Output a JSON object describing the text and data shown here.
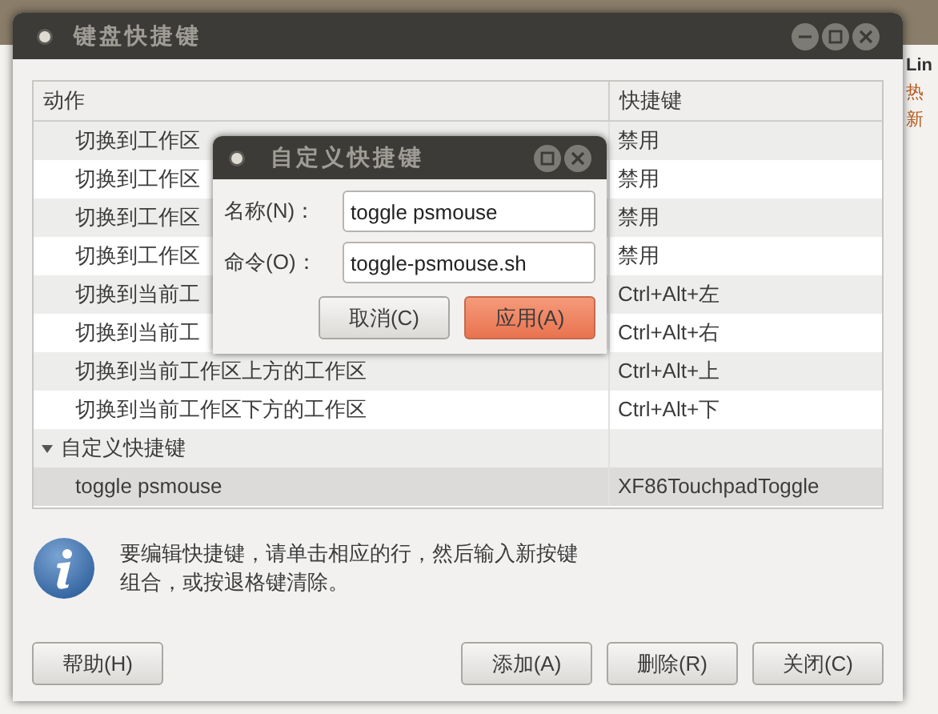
{
  "background": {
    "right_texts": [
      "Lin",
      "热",
      "新"
    ]
  },
  "window": {
    "title": "键盘快捷键"
  },
  "table": {
    "columns": [
      "动作",
      "快捷键"
    ],
    "rows": [
      {
        "kind": "item",
        "action": "切换到工作区",
        "shortcut": "禁用",
        "selected": false
      },
      {
        "kind": "item",
        "action": "切换到工作区",
        "shortcut": "禁用",
        "selected": false
      },
      {
        "kind": "item",
        "action": "切换到工作区",
        "shortcut": "禁用",
        "selected": false
      },
      {
        "kind": "item",
        "action": "切换到工作区",
        "shortcut": "禁用",
        "selected": false
      },
      {
        "kind": "item",
        "action": "切换到当前工",
        "shortcut": "Ctrl+Alt+左",
        "selected": false
      },
      {
        "kind": "item",
        "action": "切换到当前工",
        "shortcut": "Ctrl+Alt+右",
        "selected": false
      },
      {
        "kind": "item",
        "action": "切换到当前工作区上方的工作区",
        "shortcut": "Ctrl+Alt+上",
        "selected": false
      },
      {
        "kind": "item",
        "action": "切换到当前工作区下方的工作区",
        "shortcut": "Ctrl+Alt+下",
        "selected": false
      },
      {
        "kind": "group",
        "label": "自定义快捷键",
        "expanded": true
      },
      {
        "kind": "item",
        "action": "toggle psmouse",
        "shortcut": "XF86TouchpadToggle",
        "selected": true
      }
    ]
  },
  "info": {
    "lines": [
      "要编辑快捷键，请单击相应的行，然后输入新按键",
      "组合，或按退格键清除。"
    ]
  },
  "buttons": [
    {
      "label": "帮助(H)",
      "kind": "left"
    },
    {
      "label": "添加(A)",
      "kind": "right"
    },
    {
      "label": "删除(R)",
      "kind": "right"
    },
    {
      "label": "关闭(C)",
      "kind": "right"
    }
  ],
  "dialog": {
    "title": "自定义快捷键",
    "fields": [
      {
        "label": "名称(N)：",
        "value": "toggle psmouse"
      },
      {
        "label": "命令(O)：",
        "value": "toggle-psmouse.sh"
      }
    ],
    "buttons": [
      {
        "label": "取消(C)",
        "kind": "normal"
      },
      {
        "label": "应用(A)",
        "kind": "default"
      }
    ]
  }
}
